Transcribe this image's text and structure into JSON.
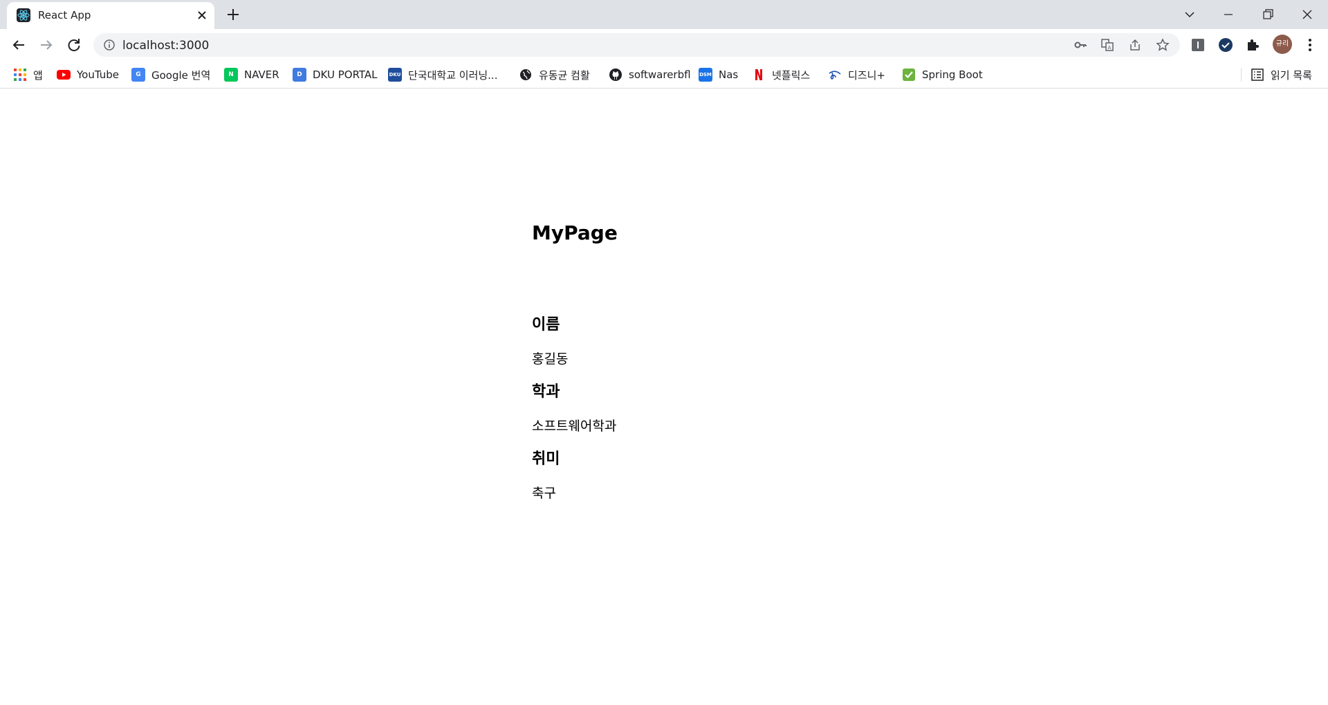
{
  "browser": {
    "tab": {
      "title": "React App",
      "favicon": "react-icon"
    },
    "url": "localhost:3000",
    "profile_label": "규리"
  },
  "bookmarks": [
    {
      "label": "앱",
      "icon": "apps-grid-icon",
      "color": "#ea4335"
    },
    {
      "label": "YouTube",
      "icon": "youtube-icon",
      "color": "#ff0000"
    },
    {
      "label": "Google 번역",
      "icon": "google-translate-icon",
      "color": "#4285f4"
    },
    {
      "label": "NAVER",
      "icon": "naver-icon",
      "color": "#03c75a"
    },
    {
      "label": "DKU PORTAL",
      "icon": "dku-portal-icon",
      "color": "#3f7be0"
    },
    {
      "label": "단국대학교 이러닝...",
      "icon": "dku-elearning-icon",
      "color": "#1f4e9c"
    },
    {
      "label": "유동균 컴활",
      "icon": "globe-icon",
      "color": "#202124"
    },
    {
      "label": "softwarerbfl",
      "icon": "github-icon",
      "color": "#202124"
    },
    {
      "label": "Nas",
      "icon": "nas-icon",
      "color": "#1a73e8"
    },
    {
      "label": "넷플릭스",
      "icon": "netflix-icon",
      "color": "#e50914"
    },
    {
      "label": "디즈니+",
      "icon": "disney-plus-icon",
      "color": "#1d4fb5"
    },
    {
      "label": "Spring Boot",
      "icon": "check-icon",
      "color": "#6db33f"
    }
  ],
  "reading_list": {
    "label": "읽기 목록",
    "icon": "reading-list-icon"
  },
  "page": {
    "title": "MyPage",
    "fields": [
      {
        "label": "이름",
        "value": "홍길동"
      },
      {
        "label": "학과",
        "value": "소프트웨어학과"
      },
      {
        "label": "취미",
        "value": "축구"
      }
    ]
  }
}
